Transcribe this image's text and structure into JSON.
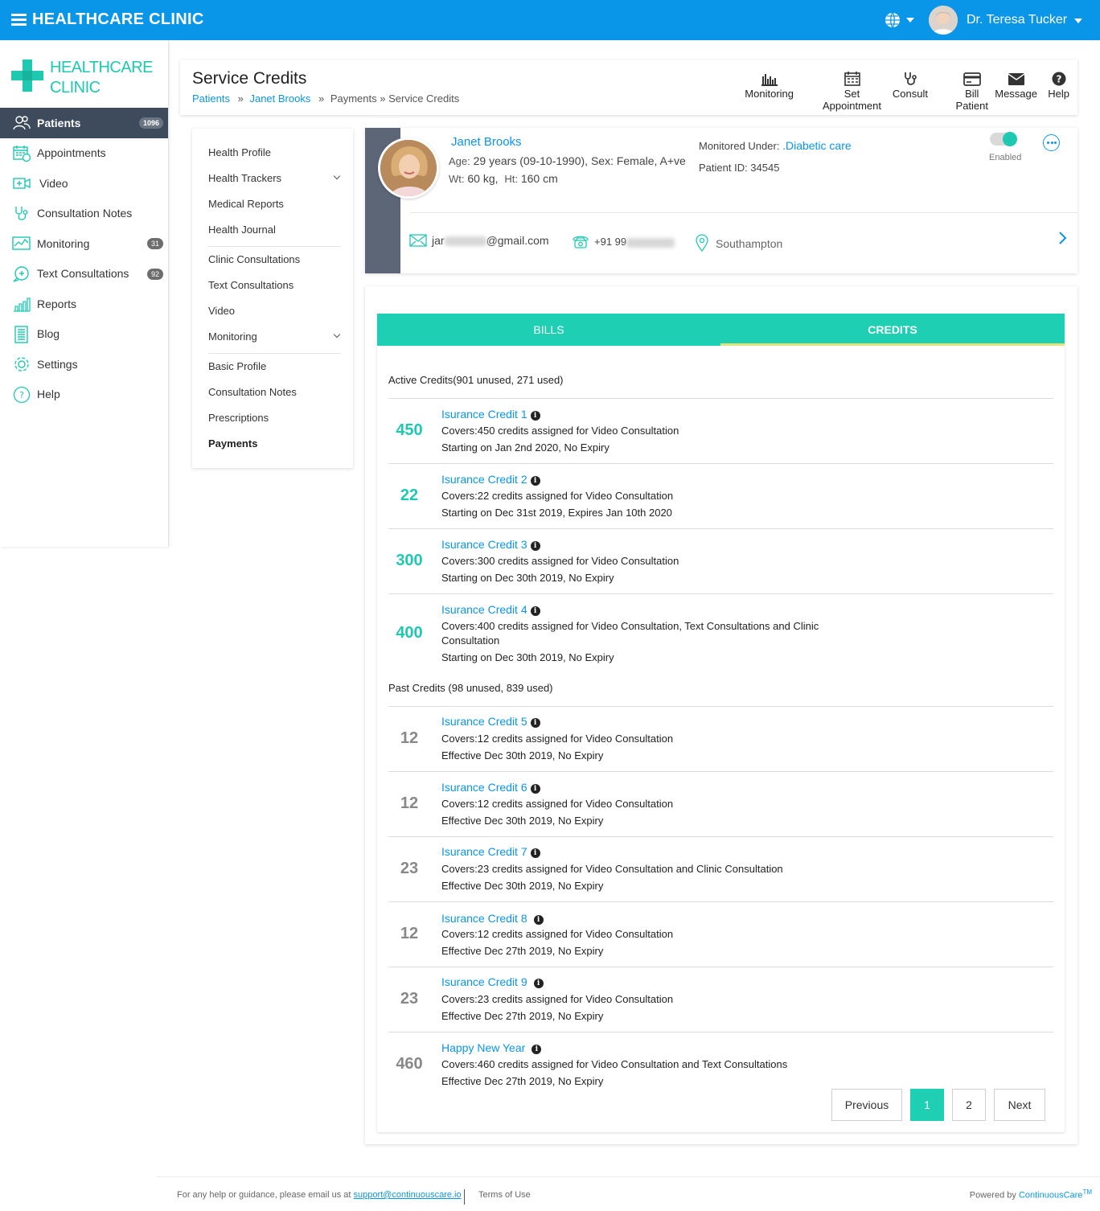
{
  "app": {
    "title": "HEALTHCARE CLINIC",
    "user_name": "Dr. Teresa Tucker"
  },
  "sidebar": {
    "logo_line1": "HEALTHCARE",
    "logo_line2": "CLINIC",
    "items": [
      {
        "label": "Patients",
        "badge": "1096",
        "icon": "patients-icon"
      },
      {
        "label": "Appointments",
        "badge": "",
        "icon": "calendar-icon"
      },
      {
        "label": "Video",
        "badge": "",
        "icon": "video-icon"
      },
      {
        "label": "Consultation Notes",
        "badge": "",
        "icon": "stethoscope-icon"
      },
      {
        "label": "Monitoring",
        "badge": "31",
        "icon": "chart-icon"
      },
      {
        "label": "Text Consultations",
        "badge": "92",
        "icon": "chat-icon"
      },
      {
        "label": "Reports",
        "badge": "",
        "icon": "reports-icon"
      },
      {
        "label": "Blog",
        "badge": "",
        "icon": "blog-icon"
      },
      {
        "label": "Settings",
        "badge": "",
        "icon": "gear-icon"
      },
      {
        "label": "Help",
        "badge": "",
        "icon": "help-icon"
      }
    ]
  },
  "header": {
    "title": "Service Credits",
    "breadcrumb": {
      "patients": "Patients",
      "sep1": "»",
      "patient": "Janet Brooks",
      "sep2": "»",
      "rest": "Payments » Service Credits"
    },
    "actions": {
      "monitoring": "Monitoring",
      "set_appointment": "Set Appointment",
      "consult": "Consult",
      "bill_patient": "Bill Patient",
      "message": "Message",
      "help": "Help"
    }
  },
  "submenu": {
    "group1": [
      "Health Profile",
      "Health Trackers",
      "Medical Reports",
      "Health Journal"
    ],
    "group2": [
      "Clinic Consultations",
      "Text Consultations",
      "Video",
      "Monitoring"
    ],
    "group3": [
      "Basic Profile",
      "Consultation Notes",
      "Prescriptions",
      "Payments"
    ]
  },
  "patient": {
    "name": "Janet Brooks",
    "age_label": "Age:",
    "age_value": "29 years (09-10-1990), Sex: Female, A+ve",
    "wt_label": "Wt:",
    "wt_value": "60 kg,",
    "ht_label": "Ht:",
    "ht_value": "160 cm",
    "monitored_label": "Monitored Under:",
    "monitored_value": ".Diabetic care",
    "patient_id": "Patient ID: 34545",
    "toggle_label": "Enabled",
    "email_prefix": "jar",
    "email_suffix": "@gmail.com",
    "phone_prefix": "+91 99",
    "location": "Southampton"
  },
  "tabs": {
    "bills": "BILLS",
    "credits": "CREDITS"
  },
  "active_header": "Active Credits(901 unused, 271 used)",
  "past_header": "Past Credits (98 unused, 839 used)",
  "active_credits": [
    {
      "amount": "450",
      "title": "Isurance Credit 1",
      "covers": "Covers:450 credits assigned for Video Consultation",
      "validity": "Starting on Jan 2nd 2020, No Expiry"
    },
    {
      "amount": "22",
      "title": "Isurance Credit 2",
      "covers": "Covers:22 credits assigned for Video Consultation",
      "validity": "Starting on Dec 31st 2019, Expires Jan 10th 2020"
    },
    {
      "amount": "300",
      "title": "Isurance Credit 3",
      "covers": "Covers:300 credits assigned for Video Consultation",
      "validity": "Starting on Dec 30th 2019, No Expiry"
    },
    {
      "amount": "400",
      "title": "Isurance Credit 4",
      "covers": "Covers:400 credits assigned for Video Consultation, Text Consultations and Clinic Consultation",
      "validity": "Starting on Dec 30th 2019, No Expiry"
    }
  ],
  "past_credits": [
    {
      "amount": "12",
      "title": "Isurance Credit 5",
      "covers": "Covers:12 credits assigned for Video Consultation",
      "validity": "Effective Dec 30th 2019, No Expiry"
    },
    {
      "amount": "12",
      "title": "Isurance Credit 6",
      "covers": "Covers:12 credits assigned for Video Consultation",
      "validity": "Effective Dec 30th 2019, No Expiry"
    },
    {
      "amount": "23",
      "title": "Isurance Credit 7",
      "covers": "Covers:23 credits assigned for Video Consultation and Clinic Consultation",
      "validity": "Effective Dec 30th 2019, No Expiry"
    },
    {
      "amount": "12",
      "title": "Isurance Credit 8",
      "covers": "Covers:12 credits assigned for Video Consultation",
      "validity": "Effective Dec 27th 2019, No Expiry"
    },
    {
      "amount": "23",
      "title": "Isurance Credit 9",
      "covers": "Covers:23 credits assigned for Video Consultation",
      "validity": "Effective Dec 27th 2019, No Expiry"
    },
    {
      "amount": "460",
      "title": "Happy New Year",
      "covers": "Covers:460 credits assigned for Video Consultation and Text Consultations",
      "validity": "Effective Dec 27th 2019, No Expiry"
    }
  ],
  "pagination": {
    "previous": "Previous",
    "page1": "1",
    "page2": "2",
    "next": "Next"
  },
  "footer": {
    "help_text": "For any help or guidance, please email us at",
    "email": "support@continuouscare.io",
    "terms": "Terms of Use",
    "powered": "Powered by",
    "brand": "ContinuousCare",
    "tm": "TM"
  },
  "colors": {
    "topbar": "#0a96e8",
    "accent": "#1fc9b1",
    "tabs": "#1fcfb4",
    "sidebar_active": "#3d4b5c"
  }
}
